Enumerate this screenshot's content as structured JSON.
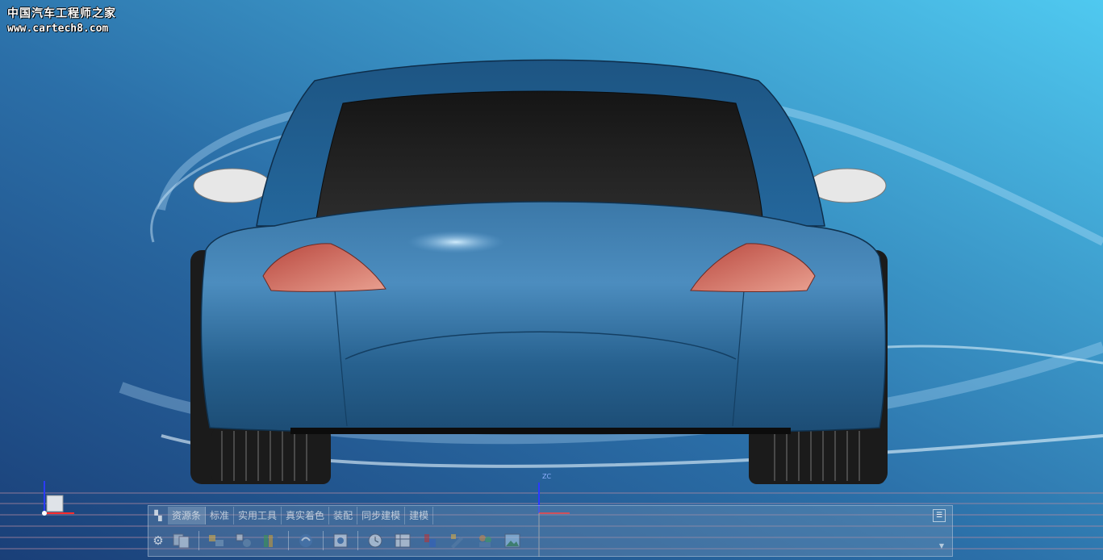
{
  "watermark": {
    "title": "中国汽车工程师之家",
    "url": "www.cartech8.com"
  },
  "triad": {
    "zc_label": "ZC"
  },
  "ribbon": {
    "tabs": [
      {
        "label": "资源条"
      },
      {
        "label": "标准"
      },
      {
        "label": "实用工具"
      },
      {
        "label": "真实着色"
      },
      {
        "label": "装配"
      },
      {
        "label": "同步建模"
      },
      {
        "label": "建模"
      }
    ],
    "tools": [
      {
        "icon": "layout-icon"
      },
      {
        "icon": "layer-settings-icon"
      },
      {
        "icon": "move-to-layer-icon"
      },
      {
        "icon": "layer-books-icon"
      },
      {
        "icon": "wave-link-icon"
      },
      {
        "icon": "information-icon"
      },
      {
        "icon": "part-navigator-icon"
      },
      {
        "icon": "history-clock-icon"
      },
      {
        "icon": "spreadsheet-icon"
      },
      {
        "icon": "paint-brush-icon"
      },
      {
        "icon": "edit-object-icon"
      },
      {
        "icon": "users-icon"
      },
      {
        "icon": "image-icon"
      }
    ]
  },
  "colors": {
    "background_light": "#4fc3ec",
    "background_dark": "#1a3f78",
    "car_body": "#255a88",
    "taillight": "#d9786a",
    "tire": "#1b1b1b"
  }
}
